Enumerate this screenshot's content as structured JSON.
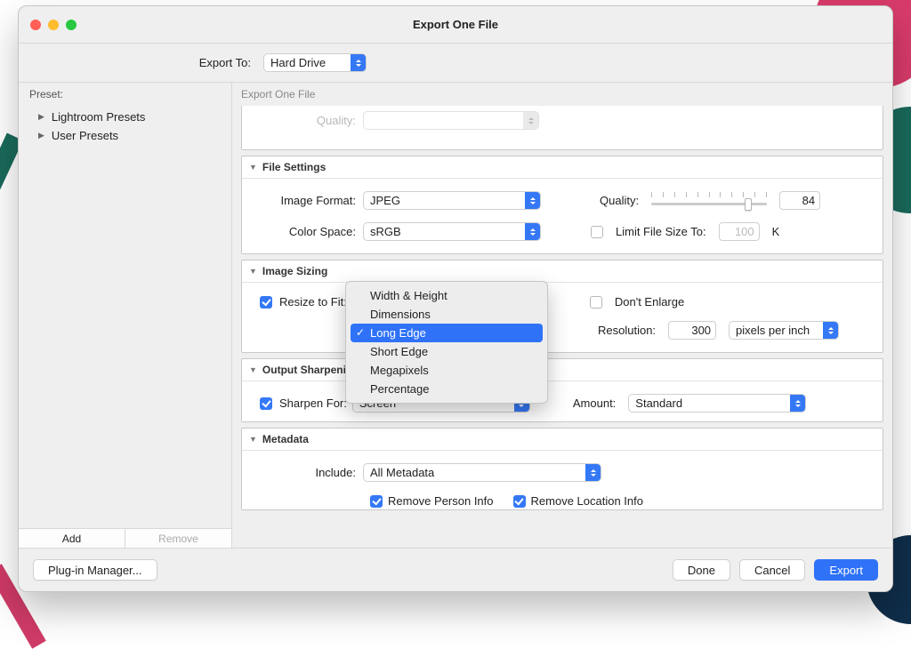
{
  "window": {
    "title": "Export One File"
  },
  "export_to": {
    "label": "Export To:",
    "value": "Hard Drive"
  },
  "sidebar": {
    "header": "Preset:",
    "items": [
      {
        "label": "Lightroom Presets"
      },
      {
        "label": "User Presets"
      }
    ],
    "add_label": "Add",
    "remove_label": "Remove"
  },
  "main": {
    "header": "Export One File",
    "quality_panel": {
      "label": "Quality:"
    },
    "file_settings": {
      "title": "File Settings",
      "image_format_label": "Image Format:",
      "image_format_value": "JPEG",
      "color_space_label": "Color Space:",
      "color_space_value": "sRGB",
      "quality_label": "Quality:",
      "quality_value": "84",
      "limit_label": "Limit File Size To:",
      "limit_value": "100",
      "limit_unit": "K"
    },
    "image_sizing": {
      "title": "Image Sizing",
      "resize_label": "Resize to Fit:",
      "menu_items": [
        "Width & Height",
        "Dimensions",
        "Long Edge",
        "Short Edge",
        "Megapixels",
        "Percentage"
      ],
      "menu_selected": "Long Edge",
      "dont_enlarge_label": "Don't Enlarge",
      "resolution_label": "Resolution:",
      "resolution_value": "300",
      "resolution_unit_value": "pixels per inch"
    },
    "output_sharpening": {
      "title": "Output Sharpening",
      "title_truncated": "Output Sharpe",
      "sharpen_for_label": "Sharpen For:",
      "sharpen_for_value": "Screen",
      "amount_label": "Amount:",
      "amount_value": "Standard"
    },
    "metadata": {
      "title": "Metadata",
      "include_label": "Include:",
      "include_value": "All Metadata",
      "remove_person_label": "Remove Person Info",
      "remove_location_label": "Remove Location Info"
    }
  },
  "footer": {
    "plugin_label": "Plug-in Manager...",
    "done_label": "Done",
    "cancel_label": "Cancel",
    "export_label": "Export"
  }
}
